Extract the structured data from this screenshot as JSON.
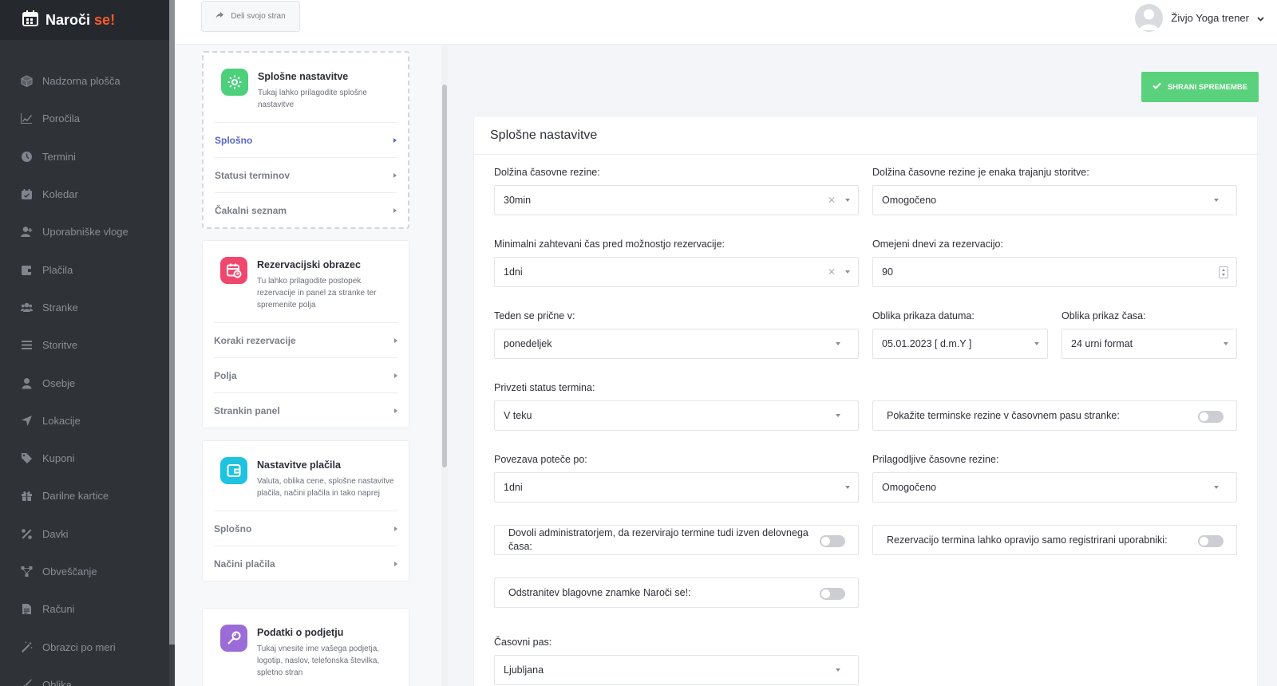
{
  "app": {
    "name_main": "Naroči",
    "name_accent": "se!"
  },
  "sidebar": {
    "items": [
      {
        "label": "Nadzorna plošča",
        "icon": "cube-icon"
      },
      {
        "label": "Poročila",
        "icon": "chart-icon"
      },
      {
        "label": "Termini",
        "icon": "clock-icon"
      },
      {
        "label": "Koledar",
        "icon": "calendar-icon"
      },
      {
        "label": "Uporabniške vloge",
        "icon": "user-plus-icon"
      },
      {
        "label": "Plačila",
        "icon": "wallet-icon"
      },
      {
        "label": "Stranke",
        "icon": "users-icon"
      },
      {
        "label": "Storitve",
        "icon": "list-icon"
      },
      {
        "label": "Osebje",
        "icon": "user-icon"
      },
      {
        "label": "Lokacije",
        "icon": "location-arrow-icon"
      },
      {
        "label": "Kuponi",
        "icon": "tag-icon"
      },
      {
        "label": "Darilne kartice",
        "icon": "gift-icon"
      },
      {
        "label": "Davki",
        "icon": "percent-icon"
      },
      {
        "label": "Obveščanje",
        "icon": "network-icon"
      },
      {
        "label": "Računi",
        "icon": "file-icon"
      },
      {
        "label": "Obrazci po meri",
        "icon": "magic-wand-icon"
      },
      {
        "label": "Oblika",
        "icon": "brush-icon"
      }
    ]
  },
  "topbar": {
    "share_label": "Deli svojo stran",
    "user_name": "Živjo Yoga trener"
  },
  "settings_nav": {
    "cards": [
      {
        "title": "Splošne nastavitve",
        "desc": "Tukaj lahko prilagodite splošne nastavitve",
        "color": "#4cd07b",
        "links": [
          "Splošno",
          "Statusi terminov",
          "Čakalni seznam"
        ]
      },
      {
        "title": "Rezervacijski obrazec",
        "desc": "Tu lahko prilagodite postopek rezervacije in panel za stranke ter spremenite polja",
        "color": "#f0476f",
        "links": [
          "Koraki rezervacije",
          "Polja",
          "Strankin panel"
        ]
      },
      {
        "title": "Nastavitve plačila",
        "desc": "Valuta, oblika cene, splošne nastavitve plačila, načini plačila in tako naprej",
        "color": "#1fc3df",
        "links": [
          "Splošno",
          "Načini plačila"
        ]
      },
      {
        "title": "Podatki o podjetju",
        "desc": "Tukaj vnesite ime vašega podjetja, logotip, naslov, telefonska številka, spletno stran",
        "color": "#9b6cd8",
        "links": []
      }
    ]
  },
  "main": {
    "save_label": "SHRANI SPREMEMBE",
    "panel_title": "Splošne nastavitve",
    "fields": {
      "slot_length": {
        "label": "Dolžina časovne rezine:",
        "value": "30min"
      },
      "slot_eq_service": {
        "label": "Dolžina časovne rezine je enaka trajanju storitve:",
        "value": "Omogočeno"
      },
      "min_time": {
        "label": "Minimalni zahtevani čas pred možnostjo rezervacije:",
        "value": "1dni"
      },
      "limited_days": {
        "label": "Omejeni dnevi za rezervacijo:",
        "value": "90"
      },
      "week_start": {
        "label": "Teden se prične v:",
        "value": "ponedeljek"
      },
      "date_format": {
        "label": "Oblika prikaza datuma:",
        "value": "05.01.2023 [ d.m.Y ]"
      },
      "time_format": {
        "label": "Oblika prikaz časa:",
        "value": "24 urni format"
      },
      "default_status": {
        "label": "Privzeti status termina:",
        "value": "V teku"
      },
      "show_timezone": {
        "label": "Pokažite terminske rezine v časovnem pasu stranke:"
      },
      "link_expires": {
        "label": "Povezava poteče po:",
        "value": "1dni"
      },
      "flexible_slots": {
        "label": "Prilagodljive časovne rezine:",
        "value": "Omogočeno"
      },
      "admin_outside": {
        "label": "Dovoli administratorjem, da rezervirajo termine tudi izven delovnega časa:"
      },
      "registered_only": {
        "label": "Rezervacijo termina lahko opravijo samo registrirani uporabniki:"
      },
      "remove_brand": {
        "label": "Odstranitev blagovne znamke Naroči se!:"
      },
      "timezone": {
        "label": "Časovni pas:",
        "value": "Ljubljana"
      }
    }
  }
}
